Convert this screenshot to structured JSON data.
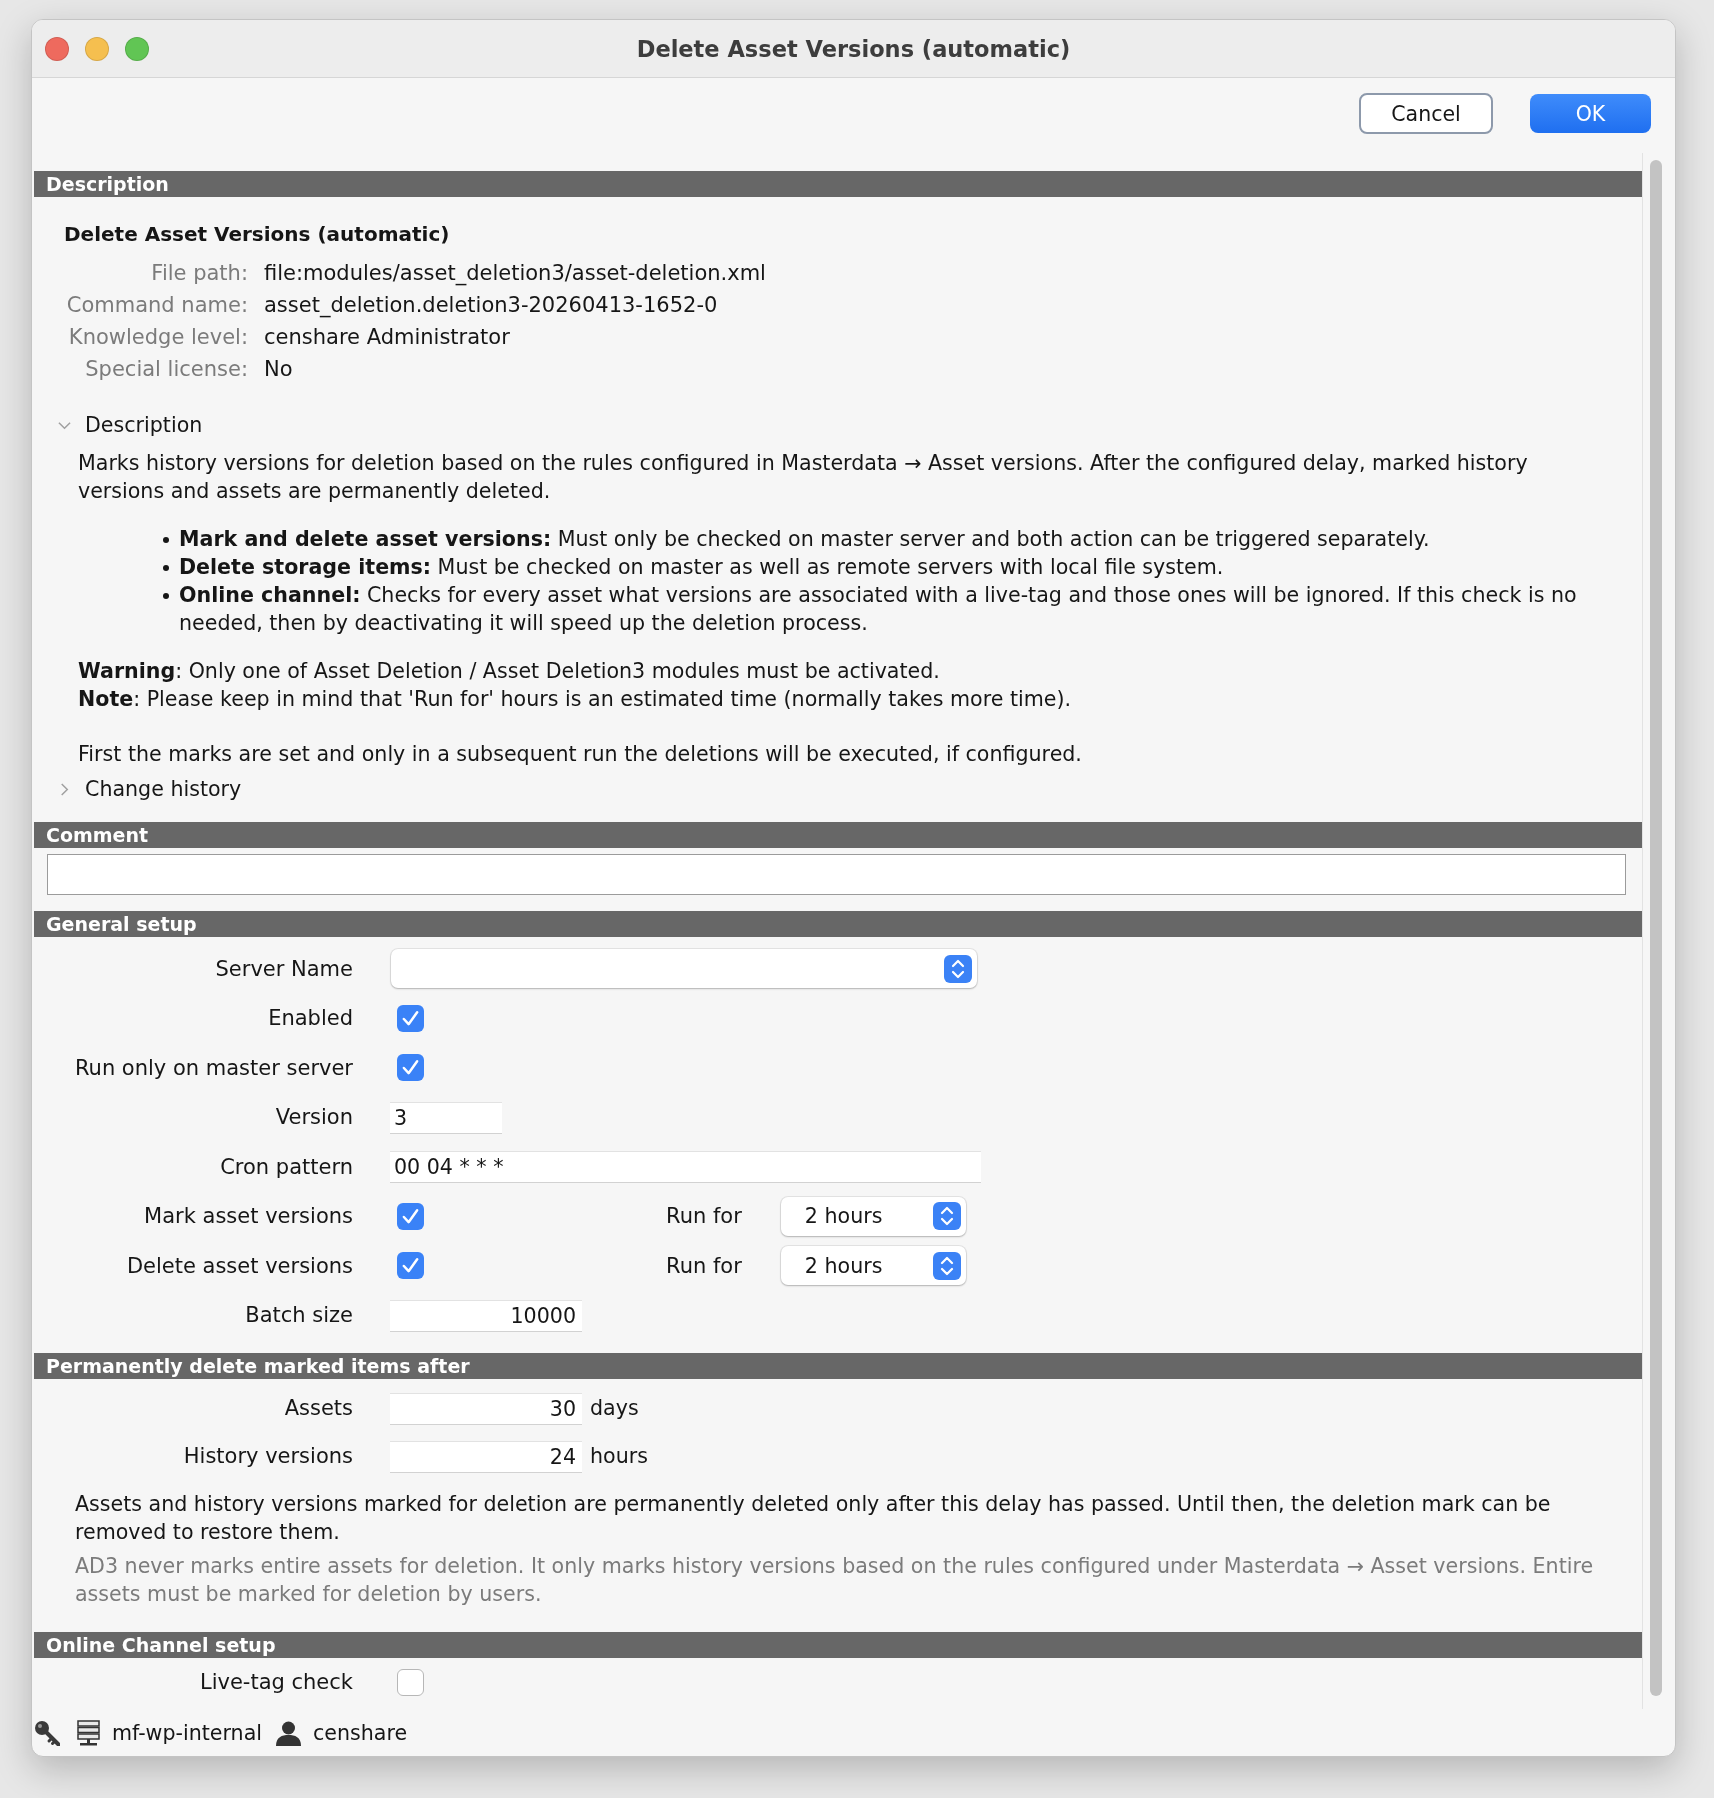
{
  "window": {
    "title": "Delete Asset Versions (automatic)"
  },
  "buttons": [
    {
      "label": "Cancel",
      "kind": "cancel"
    },
    {
      "label": "OK",
      "kind": "confirm"
    }
  ],
  "description": {
    "header": "Description",
    "title": "Delete Asset Versions (automatic)",
    "properties": [
      {
        "label": "File path:",
        "value": "file:modules/asset_deletion3/asset-deletion.xml"
      },
      {
        "label": "Command name:",
        "value": "asset_deletion.deletion3-20260413-1652-0"
      },
      {
        "label": "Knowledge level:",
        "value": "censhare Administrator"
      },
      {
        "label": "Special license:",
        "value": "No"
      }
    ],
    "disclosures": [
      {
        "label": "Description",
        "expanded": true,
        "intro": "Marks history versions for deletion based on the rules configured in Masterdata → Asset versions. After the configured delay, marked history versions and assets are permanently deleted.",
        "bullets": [
          "**Mark and delete asset versions:** Must only be checked on master server and both action can be triggered separately.",
          "**Delete storage items:** Must be checked on master as well as remote servers with local file system.",
          "**Online channel:** Checks for every asset what versions are associated with a live-tag and those ones will be ignored. If this check is no needed, then by deactivating it will speed up the deletion process."
        ],
        "notes": [
          "**Warning**: Only one of Asset Deletion / Asset Deletion3 modules must be activated.",
          "**Note**: Please keep in mind that 'Run for' hours is an estimated time (normally takes more time)."
        ],
        "closing": "First the marks are set and only in a subsequent run the deletions will be executed, if configured."
      },
      {
        "label": "Change history",
        "expanded": false
      }
    ]
  },
  "comment": {
    "header": "Comment"
  },
  "general_setup": {
    "header": "General setup",
    "rows": [
      {
        "kind": "select",
        "label": "Server Name"
      },
      {
        "kind": "checkbox",
        "label": "Enabled",
        "checked": true
      },
      {
        "kind": "checkbox",
        "label": "Run only on master server",
        "checked": true
      },
      {
        "kind": "short_text",
        "label": "Version",
        "value": "3"
      },
      {
        "kind": "long_text",
        "label": "Cron pattern",
        "value": "00 04 * * *"
      },
      {
        "kind": "checkbox_duration",
        "label": "Mark asset versions",
        "checked": true,
        "duration_label": "Run for",
        "duration": "2 hours"
      },
      {
        "kind": "checkbox_duration",
        "label": "Delete asset versions",
        "checked": true,
        "duration_label": "Run for",
        "duration": "2 hours"
      },
      {
        "kind": "number",
        "label": "Batch size",
        "value": "10000"
      }
    ]
  },
  "deletion_delay": {
    "header": "Permanently delete marked items after",
    "rows": [
      {
        "label": "Assets",
        "value": "30",
        "unit": "days"
      },
      {
        "label": "History versions",
        "value": "24",
        "unit": "hours"
      }
    ],
    "info": "Assets and history versions marked for deletion are permanently deleted only after this delay has passed. Until then, the deletion mark can be removed to restore them.",
    "hint": "AD3 never marks entire assets for deletion. It only marks history versions based on the rules configured under Masterdata → Asset versions. Entire assets must be marked for deletion by users."
  },
  "online_channel": {
    "header": "Online Channel setup",
    "rows": [
      {
        "kind": "checkbox",
        "label": "Live-tag check",
        "checked": false
      }
    ]
  },
  "status_bar": {
    "server": "mf-wp-internal",
    "user": "censhare"
  }
}
